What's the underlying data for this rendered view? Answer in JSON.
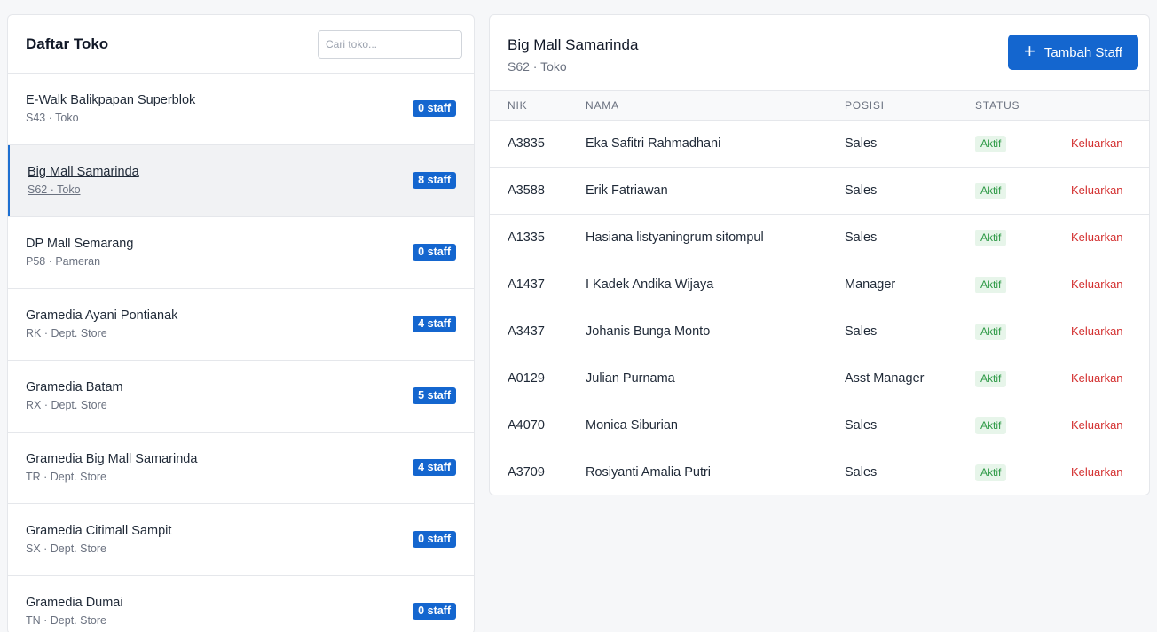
{
  "left": {
    "title": "Daftar Toko",
    "search_placeholder": "Cari toko...",
    "stores": [
      {
        "name": "E-Walk Balikpapan Superblok",
        "sub": "S43 · Toko",
        "staff": "0 staff"
      },
      {
        "name": "Big Mall Samarinda",
        "sub": "S62 · Toko",
        "staff": "8 staff"
      },
      {
        "name": "DP Mall Semarang",
        "sub": "P58 · Pameran",
        "staff": "0 staff"
      },
      {
        "name": "Gramedia Ayani Pontianak",
        "sub": "RK · Dept. Store",
        "staff": "4 staff"
      },
      {
        "name": "Gramedia Batam",
        "sub": "RX · Dept. Store",
        "staff": "5 staff"
      },
      {
        "name": "Gramedia Big Mall Samarinda",
        "sub": "TR · Dept. Store",
        "staff": "4 staff"
      },
      {
        "name": "Gramedia Citimall Sampit",
        "sub": "SX · Dept. Store",
        "staff": "0 staff"
      },
      {
        "name": "Gramedia Dumai",
        "sub": "TN · Dept. Store",
        "staff": "0 staff"
      }
    ]
  },
  "right": {
    "title": "Big Mall Samarinda",
    "sub": "S62 · Toko",
    "add_button_label": "Tambah Staff",
    "columns": {
      "nik": "NIK",
      "nama": "NAMA",
      "posisi": "POSISI",
      "status": "STATUS"
    },
    "rows": [
      {
        "nik": "A3835",
        "nama": "Eka Safitri Rahmadhani",
        "posisi": "Sales",
        "status": "Aktif",
        "action": "Keluarkan"
      },
      {
        "nik": "A3588",
        "nama": "Erik Fatriawan",
        "posisi": "Sales",
        "status": "Aktif",
        "action": "Keluarkan"
      },
      {
        "nik": "A1335",
        "nama": "Hasiana listyaningrum sitompul",
        "posisi": "Sales",
        "status": "Aktif",
        "action": "Keluarkan"
      },
      {
        "nik": "A1437",
        "nama": "I Kadek Andika Wijaya",
        "posisi": "Manager",
        "status": "Aktif",
        "action": "Keluarkan"
      },
      {
        "nik": "A3437",
        "nama": "Johanis Bunga Monto",
        "posisi": "Sales",
        "status": "Aktif",
        "action": "Keluarkan"
      },
      {
        "nik": "A0129",
        "nama": "Julian Purnama",
        "posisi": "Asst Manager",
        "status": "Aktif",
        "action": "Keluarkan"
      },
      {
        "nik": "A4070",
        "nama": "Monica Siburian",
        "posisi": "Sales",
        "status": "Aktif",
        "action": "Keluarkan"
      },
      {
        "nik": "A3709",
        "nama": "Rosiyanti Amalia Putri",
        "posisi": "Sales",
        "status": "Aktif",
        "action": "Keluarkan"
      }
    ]
  },
  "colors": {
    "accent": "#1466cf",
    "status_bg": "#e7f5ea",
    "status_text": "#2f9a47",
    "danger": "#d32f2f"
  },
  "icons": {
    "add": "plus-icon"
  }
}
